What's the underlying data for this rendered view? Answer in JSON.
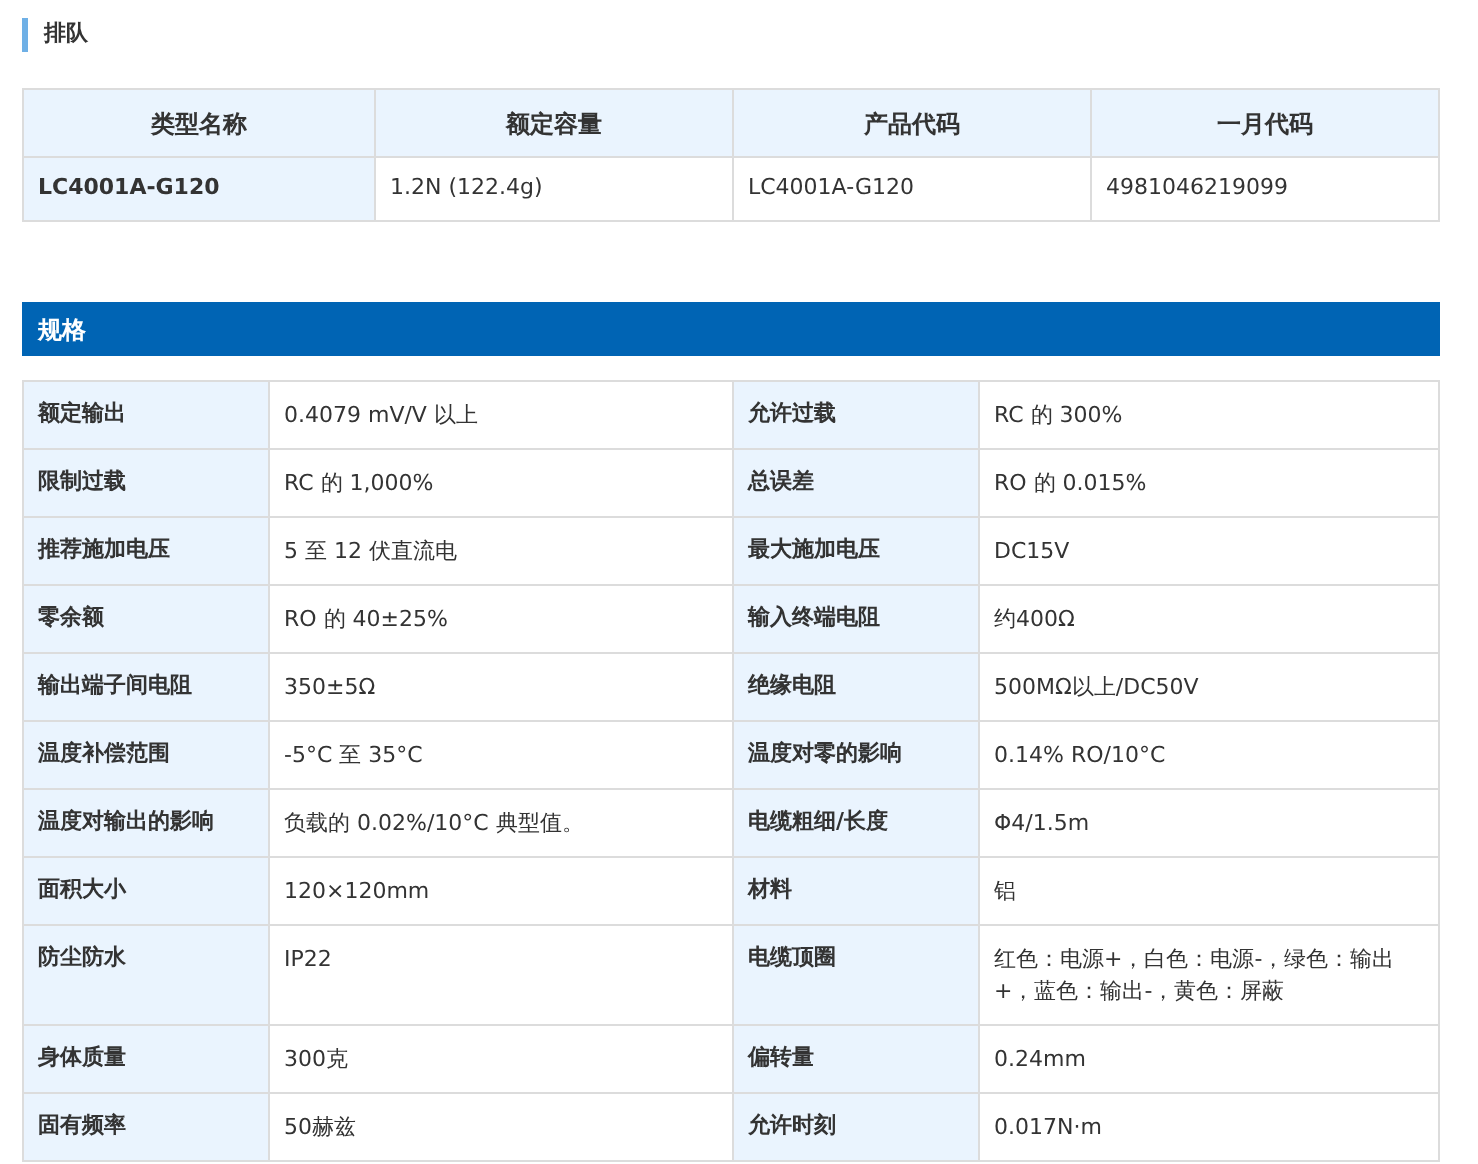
{
  "lineup": {
    "title": "排队",
    "columns": [
      "类型名称",
      "额定容量",
      "产品代码",
      "一月代码"
    ],
    "rows": [
      [
        "LC4001A-G120",
        "1.2N (122.4g)",
        "LC4001A-G120",
        "4981046219099"
      ]
    ]
  },
  "specs": {
    "title": "规格",
    "rows": [
      [
        {
          "label": "额定输出",
          "value": "0.4079 mV/V 以上"
        },
        {
          "label": "允许过载",
          "value": "RC 的 300%"
        }
      ],
      [
        {
          "label": "限制过载",
          "value": "RC 的 1,000%"
        },
        {
          "label": "总误差",
          "value": "RO 的 0.015%"
        }
      ],
      [
        {
          "label": "推荐施加电压",
          "value": "5 至 12 伏直流电"
        },
        {
          "label": "最大施加电压",
          "value": "DC15V"
        }
      ],
      [
        {
          "label": "零余额",
          "value": "RO 的 40±25%"
        },
        {
          "label": "输入终端电阻",
          "value": "约400Ω"
        }
      ],
      [
        {
          "label": "输出端子间电阻",
          "value": "350±5Ω"
        },
        {
          "label": "绝缘电阻",
          "value": "500MΩ以上/DC50V"
        }
      ],
      [
        {
          "label": "温度补偿范围",
          "value": "-5°C 至 35°C"
        },
        {
          "label": "温度对零的影响",
          "value": "0.14% RO/10°C"
        }
      ],
      [
        {
          "label": "温度对输出的影响",
          "value": "负载的 0.02%/10°C 典型值。"
        },
        {
          "label": "电缆粗细/长度",
          "value": "Φ4/1.5m"
        }
      ],
      [
        {
          "label": "面积大小",
          "value": "120×120mm"
        },
        {
          "label": "材料",
          "value": "铝"
        }
      ],
      [
        {
          "label": "防尘防水",
          "value": "IP22"
        },
        {
          "label": "电缆顶圈",
          "value": "红色：电源+，白色：电源-，绿色：输出+，蓝色：输出-，黄色：屏蔽"
        }
      ],
      [
        {
          "label": "身体质量",
          "value": "300克"
        },
        {
          "label": "偏转量",
          "value": "0.24mm"
        }
      ],
      [
        {
          "label": "固有频率",
          "value": "50赫兹"
        },
        {
          "label": "允许时刻",
          "value": "0.017N·m"
        }
      ]
    ]
  }
}
